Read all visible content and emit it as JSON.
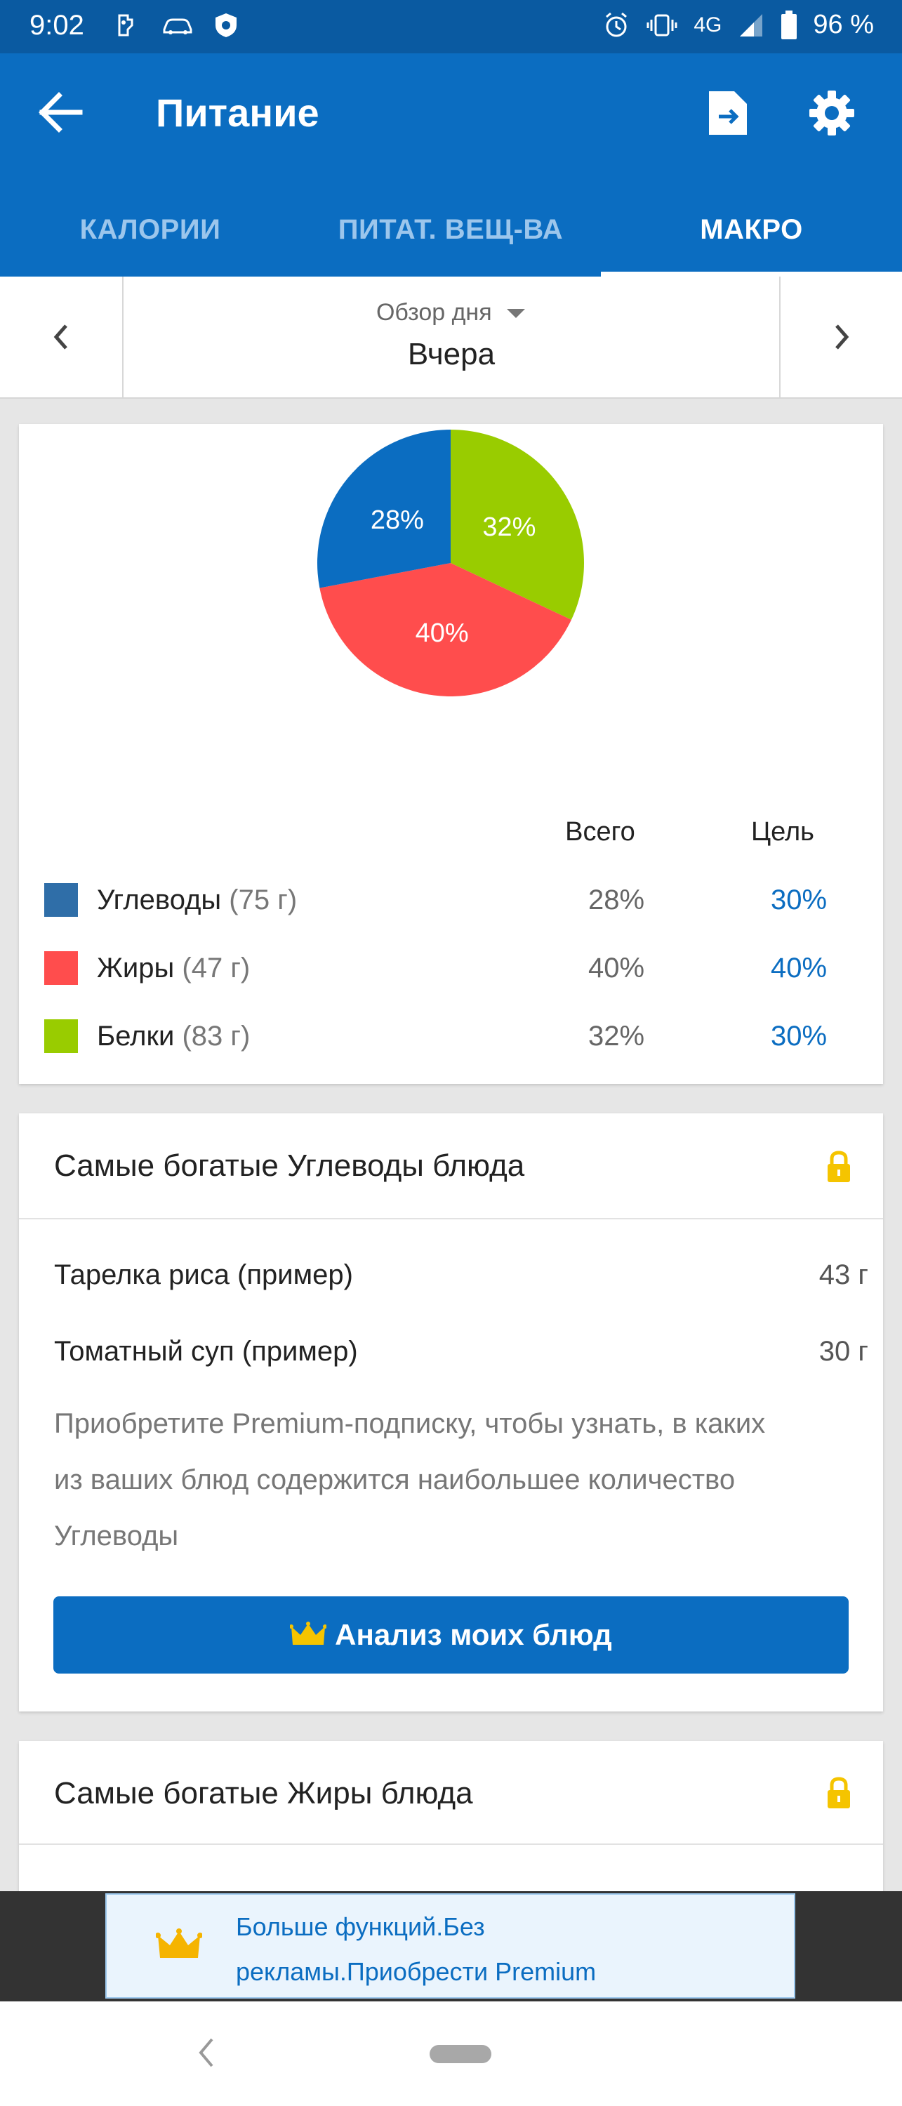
{
  "status_bar": {
    "time": "9:02",
    "network": "4G",
    "battery": "96 %"
  },
  "app_bar": {
    "title": "Питание"
  },
  "tabs": [
    {
      "label": "КАЛОРИИ"
    },
    {
      "label": "ПИТАТ. ВЕЩ-ВА"
    },
    {
      "label": "МАКРО",
      "active": true
    }
  ],
  "day_selector": {
    "mode": "Обзор дня",
    "day": "Вчера"
  },
  "chart_data": {
    "type": "pie",
    "slices": [
      {
        "label": "Белки",
        "value": 32,
        "display": "32%",
        "color": "#99cc00"
      },
      {
        "label": "Жиры",
        "value": 40,
        "display": "40%",
        "color": "#ff4d4d"
      },
      {
        "label": "Углеводы",
        "value": 28,
        "display": "28%",
        "color": "#0b6dc1"
      }
    ]
  },
  "macros": {
    "header_total": "Всего",
    "header_goal": "Цель",
    "rows": [
      {
        "name": "Углеводы",
        "grams": "(75 г)",
        "total": "28%",
        "goal": "30%",
        "color": "#2f6ea8"
      },
      {
        "name": "Жиры",
        "grams": "(47 г)",
        "total": "40%",
        "goal": "40%",
        "color": "#ff4d4d"
      },
      {
        "name": "Белки",
        "grams": "(83 г)",
        "total": "32%",
        "goal": "30%",
        "color": "#99cc00"
      }
    ]
  },
  "carbs_card": {
    "title": "Самые богатые Углеводы блюда",
    "foods": [
      {
        "name": "Тарелка риса (пример)",
        "amount": "43 г"
      },
      {
        "name": "Томатный суп (пример)",
        "amount": "30 г"
      }
    ],
    "promo_lines": [
      "Приобретите Premium-подписку, чтобы узнать, в каких",
      "из ваших блюд содержится наибольшее количество",
      "Углеводы"
    ],
    "button_label": "Анализ моих блюд"
  },
  "fats_card": {
    "title": "Самые богатые Жиры блюда"
  },
  "banner": {
    "line1": "Больше функций.Без",
    "line2": "рекламы.Приобрести Premium"
  },
  "colors": {
    "primary": "#0b6dc1",
    "statusbar": "#0a5aa1",
    "lock": "#f5c400"
  }
}
